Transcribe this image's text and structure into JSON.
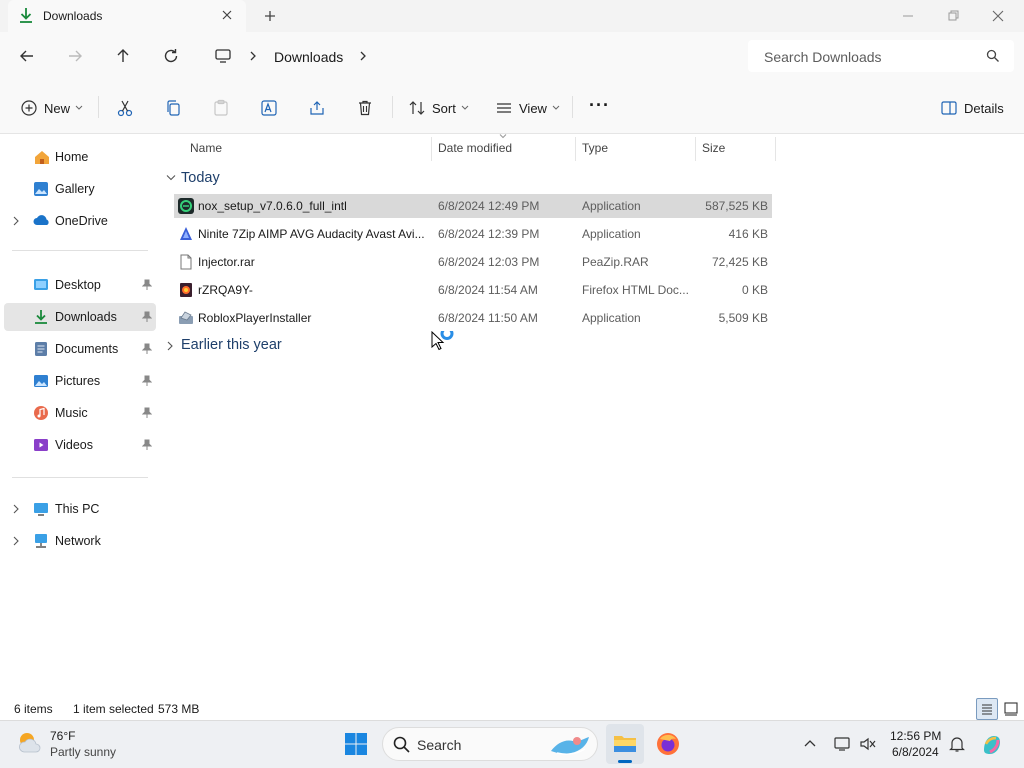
{
  "window": {
    "tab_title": "Downloads",
    "new_tab_label": "+"
  },
  "address": {
    "crumb": "Downloads",
    "search_placeholder": "Search Downloads"
  },
  "commandbar": {
    "new_label": "New",
    "sort_label": "Sort",
    "view_label": "View",
    "more_label": "···",
    "details_label": "Details"
  },
  "sidebar": {
    "items": [
      {
        "label": "Home",
        "icon": "home-icon"
      },
      {
        "label": "Gallery",
        "icon": "gallery-icon"
      },
      {
        "label": "OneDrive",
        "icon": "onedrive-icon"
      },
      {
        "label": "Desktop",
        "icon": "desktop-icon"
      },
      {
        "label": "Downloads",
        "icon": "downloads-icon"
      },
      {
        "label": "Documents",
        "icon": "documents-icon"
      },
      {
        "label": "Pictures",
        "icon": "pictures-icon"
      },
      {
        "label": "Music",
        "icon": "music-icon"
      },
      {
        "label": "Videos",
        "icon": "videos-icon"
      },
      {
        "label": "This PC",
        "icon": "this-pc-icon"
      },
      {
        "label": "Network",
        "icon": "network-icon"
      }
    ]
  },
  "columns": {
    "name": "Name",
    "date": "Date modified",
    "type": "Type",
    "size": "Size"
  },
  "groups": {
    "today": "Today",
    "earlier": "Earlier this year"
  },
  "files": [
    {
      "name": "nox_setup_v7.0.6.0_full_intl",
      "date": "6/8/2024 12:49 PM",
      "type": "Application",
      "size": "587,525 KB",
      "icon": "nox-app-icon"
    },
    {
      "name": "Ninite 7Zip AIMP AVG Audacity Avast Avi...",
      "date": "6/8/2024 12:39 PM",
      "type": "Application",
      "size": "416 KB",
      "icon": "ninite-app-icon"
    },
    {
      "name": "Injector.rar",
      "date": "6/8/2024 12:03 PM",
      "type": "PeaZip.RAR",
      "size": "72,425 KB",
      "icon": "file-icon"
    },
    {
      "name": "rZRQA9Y-",
      "date": "6/8/2024 11:54 AM",
      "type": "Firefox HTML Doc...",
      "size": "0 KB",
      "icon": "html-doc-icon"
    },
    {
      "name": "RobloxPlayerInstaller",
      "date": "6/8/2024 11:50 AM",
      "type": "Application",
      "size": "5,509 KB",
      "icon": "installer-icon"
    }
  ],
  "status": {
    "item_count": "6 items",
    "selected": "1 item selected",
    "selected_size": "573 MB"
  },
  "taskbar": {
    "temp": "76°F",
    "condition": "Partly sunny",
    "search_label": "Search",
    "time": "12:56 PM",
    "date": "6/8/2024"
  },
  "colors": {
    "accent": "#0067c0",
    "selection": "#d9d9d9",
    "group_text": "#1e3f6b"
  }
}
